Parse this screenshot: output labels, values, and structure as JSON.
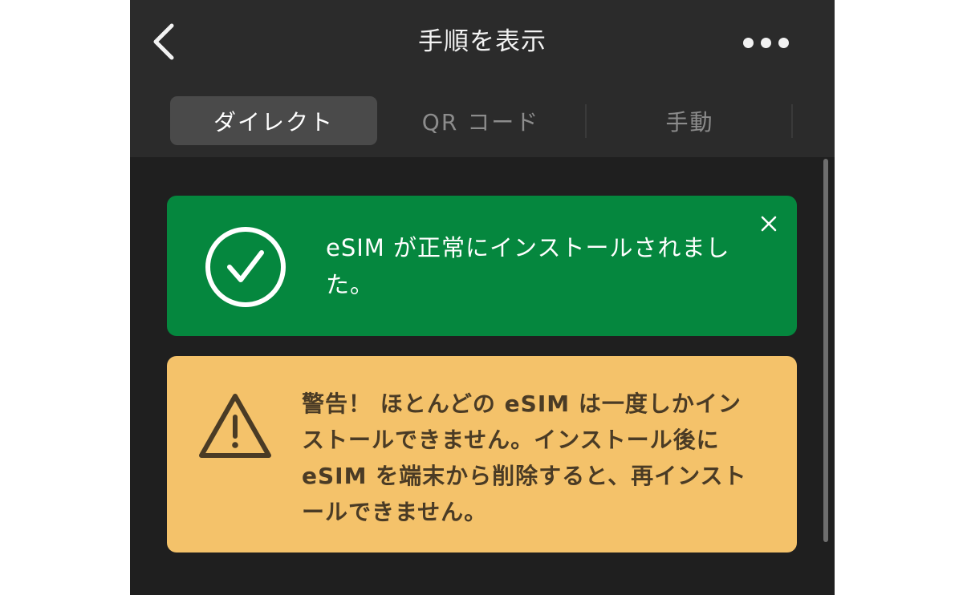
{
  "header": {
    "title": "手順を表示",
    "back_icon": "chevron-left-icon",
    "more_icon": "more-horizontal-icon"
  },
  "tabs": [
    {
      "label": "ダイレクト",
      "active": true
    },
    {
      "label": "QR コード",
      "active": false
    },
    {
      "label": "手動",
      "active": false
    }
  ],
  "success_banner": {
    "message": "eSIM が正常にインストールされました。",
    "icon": "check-circle-icon",
    "close_icon": "close-icon",
    "color": "#05873e"
  },
  "warning_banner": {
    "message": "警告！ ほとんどの eSIM は一度しかインストールできません。インストール後に eSIM を端末から削除すると、再インストールできません。",
    "icon": "warning-triangle-icon",
    "color": "#f4c26a"
  }
}
